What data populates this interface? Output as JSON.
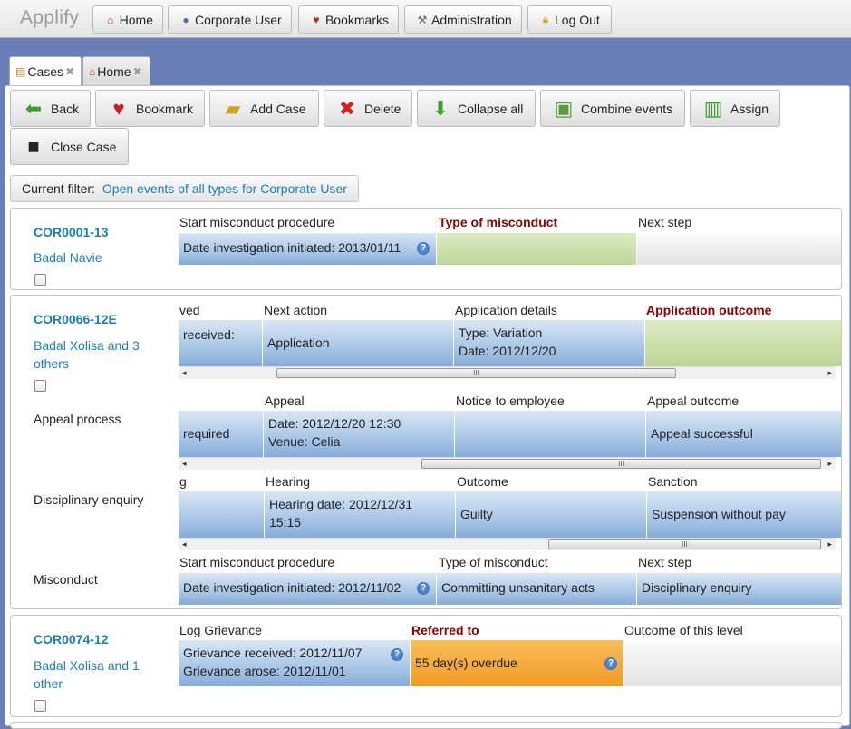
{
  "app": {
    "title": "Applify"
  },
  "topnav": [
    {
      "label": "Home",
      "icon": "home-icon"
    },
    {
      "label": "Corporate User",
      "icon": "user-icon"
    },
    {
      "label": "Bookmarks",
      "icon": "heart-icon"
    },
    {
      "label": "Administration",
      "icon": "tools-icon"
    },
    {
      "label": "Log Out",
      "icon": "lock-icon"
    }
  ],
  "tabs": [
    {
      "label": "Cases",
      "icon": "cases-icon",
      "close": "✖"
    },
    {
      "label": "Home",
      "icon": "home-icon",
      "close": "✖"
    }
  ],
  "toolbar": {
    "back": "Back",
    "bookmark": "Bookmark",
    "add_case": "Add Case",
    "delete": "Delete",
    "collapse_all": "Collapse all",
    "combine_events": "Combine events",
    "assign": "Assign",
    "close_case": "Close Case"
  },
  "filter": {
    "label": "Current filter:",
    "value": "Open events of all types for Corporate User"
  },
  "help_glyph": "?",
  "scroll": {
    "left": "◂",
    "right": "▸",
    "grip": "III"
  },
  "cases": [
    {
      "id": "COR0001-13",
      "party": "Badal Navie",
      "processes": [
        {
          "label": "",
          "columns": [
            "Start misconduct procedure",
            "Type of misconduct",
            "Next step"
          ],
          "cells": [
            "Date investigation initiated: 2013/01/11",
            "",
            ""
          ]
        }
      ]
    },
    {
      "id": "COR0066-12E",
      "party": "Badal Xolisa and 3 others",
      "processes": [
        {
          "label": "",
          "columns": [
            "ved",
            "Next action",
            "Application details",
            "Application outcome"
          ],
          "cells": [
            "received:",
            "Application",
            "Type: Variation",
            "Date: 2012/12/20",
            ""
          ]
        },
        {
          "label": "Appeal process",
          "columns": [
            "Appeal",
            "Notice to employee",
            "Appeal outcome"
          ],
          "cells": [
            "required",
            "Date: 2012/12/20 12:30",
            "Venue: Celia",
            "",
            "Appeal successful"
          ]
        },
        {
          "label": "Disciplinary enquiry",
          "columns": [
            "g",
            "Hearing",
            "Outcome",
            "Sanction"
          ],
          "cells": [
            "",
            "Hearing date: 2012/12/31",
            "15:15",
            "Guilty",
            "Suspension without pay"
          ]
        },
        {
          "label": "Misconduct",
          "columns": [
            "Start misconduct procedure",
            "Type of misconduct",
            "Next step"
          ],
          "cells": [
            "Date investigation initiated: 2012/11/02",
            "Committing unsanitary acts",
            "Disciplinary enquiry"
          ]
        }
      ]
    },
    {
      "id": "COR0074-12",
      "party": "Badal Xolisa and 1 other",
      "processes": [
        {
          "label": "",
          "columns": [
            "Log Grievance",
            "Referred to",
            "Outcome of this level"
          ],
          "cells": [
            "Grievance received: 2012/11/07",
            "Grievance arose: 2012/11/01",
            "55 day(s) overdue",
            ""
          ]
        }
      ]
    }
  ]
}
